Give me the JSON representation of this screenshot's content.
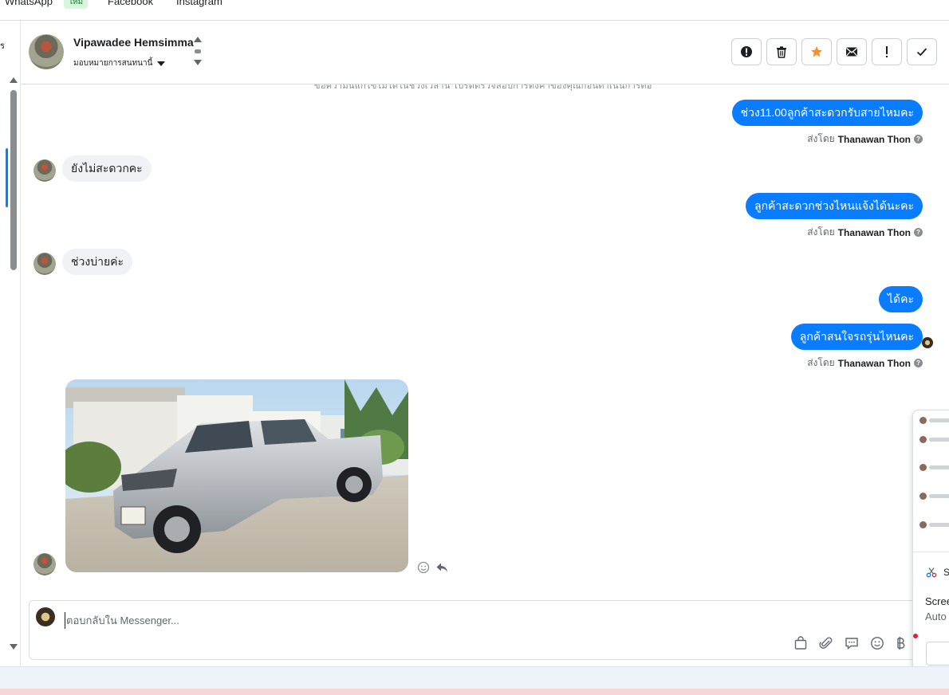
{
  "topnav": {
    "tabs": [
      "WhatsApp",
      "Facebook",
      "Instagram"
    ],
    "new_badge": "ใหม่"
  },
  "leftcol": {
    "cut_label": "ร"
  },
  "header": {
    "contact_name": "Vipawadee Hemsimma",
    "assign_label": "มอบหมายการสนทนานี้",
    "actions": [
      "alert-circle-icon",
      "trash-icon",
      "star-icon",
      "mail-icon",
      "exclamation-icon",
      "check-icon"
    ],
    "star_color": "#f5922f"
  },
  "chat": {
    "truncated_line": "ข้อความนี้แก้ไขไม่ได้ในช่วงเวลานี้ โปรดตรวจสอบการตั้งค่าของคุณก่อนดำเนินการต่อ",
    "messages": [
      {
        "side": "out",
        "text": "ช่วง11.00ลูกค้าสะดวกรับสายไหมคะ",
        "sent_by_label": "ส่งโดย",
        "agent": "Thanawan Thon"
      },
      {
        "side": "in",
        "text": "ยังไม่สะดวกคะ"
      },
      {
        "side": "out",
        "text": "ลูกค้าสะดวกช่วงไหนแจ้งได้นะคะ",
        "sent_by_label": "ส่งโดย",
        "agent": "Thanawan Thon"
      },
      {
        "side": "in",
        "text": "ช่วงบ่ายค่ะ"
      },
      {
        "side": "out",
        "text": "ได้คะ"
      },
      {
        "side": "out",
        "text": "ลูกค้าสนใจรถรุ่นไหนคะ",
        "sent_by_label": "ส่งโดย",
        "agent": "Thanawan Thon"
      },
      {
        "side": "in",
        "type": "image",
        "subject": "silver pickup truck photo"
      }
    ],
    "bubble_color_out": "#0a7cff",
    "bubble_color_in": "#f0f2f5"
  },
  "composer": {
    "placeholder": "ตอบกลับใน Messenger...",
    "tools": [
      "shopping-bag-icon",
      "paperclip-icon",
      "saved-reply-icon",
      "emoji-icon",
      "baht-icon"
    ]
  },
  "overlay": {
    "app_label": "S",
    "title_text": "Scree",
    "subtitle_text": "Auto"
  }
}
